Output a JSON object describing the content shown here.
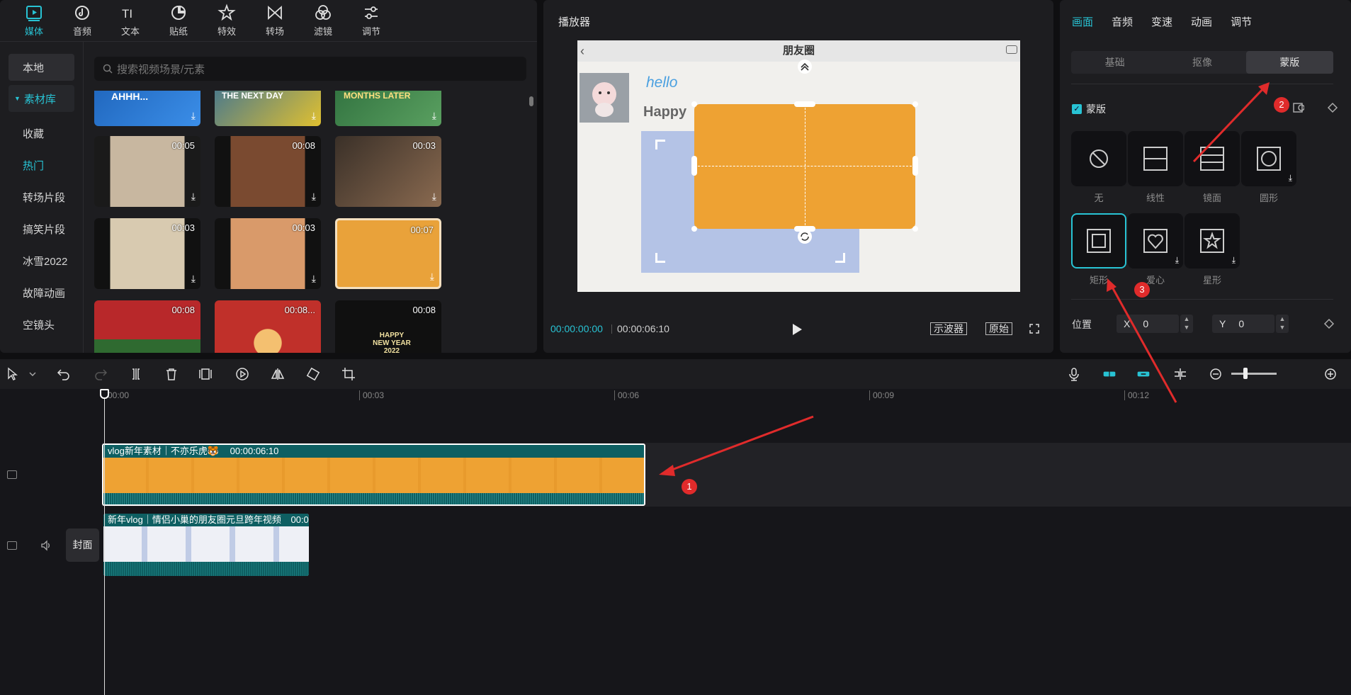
{
  "media": {
    "tabs": [
      {
        "label": "媒体",
        "icon": "media-icon",
        "active": true
      },
      {
        "label": "音频",
        "icon": "audio-icon"
      },
      {
        "label": "文本",
        "icon": "text-icon"
      },
      {
        "label": "贴纸",
        "icon": "sticker-icon"
      },
      {
        "label": "特效",
        "icon": "effects-icon"
      },
      {
        "label": "转场",
        "icon": "transition-icon"
      },
      {
        "label": "滤镜",
        "icon": "filter-icon"
      },
      {
        "label": "调节",
        "icon": "adjust-icon"
      }
    ],
    "sidebar": {
      "local": "本地",
      "library": "素材库",
      "items": [
        "收藏",
        "热门",
        "转场片段",
        "搞笑片段",
        "冰雪2022",
        "故障动画",
        "空镜头"
      ],
      "active": "热门"
    },
    "search_placeholder": "搜索视频场景/元素",
    "thumbnails": [
      {
        "duration": "",
        "text": "AHHH..."
      },
      {
        "duration": "",
        "text": "THE NEXT DAY"
      },
      {
        "duration": "",
        "text": "MONTHS LATER"
      },
      {
        "duration": "00:05"
      },
      {
        "duration": "00:08"
      },
      {
        "duration": "00:03"
      },
      {
        "duration": "00:03"
      },
      {
        "duration": "00:03"
      },
      {
        "duration": "00:07"
      },
      {
        "duration": "00:08"
      },
      {
        "duration": "00:08..."
      },
      {
        "duration": "00:08",
        "text": "HAPPY NEW YEAR 2022"
      }
    ]
  },
  "player": {
    "title": "播放器",
    "frame_title": "朋友圈",
    "hello": "hello",
    "happy": "Happy",
    "time_current": "00:00:00:00",
    "time_total": "00:00:06:10",
    "scope_btn": "示波器",
    "original_btn": "原始"
  },
  "inspector": {
    "tabs": [
      "画面",
      "音频",
      "变速",
      "动画",
      "调节"
    ],
    "active_tab": "画面",
    "segments": [
      "基础",
      "抠像",
      "蒙版"
    ],
    "active_segment": "蒙版",
    "mask_label": "蒙版",
    "mask_options": [
      {
        "label": "无",
        "icon": "none-icon"
      },
      {
        "label": "线性",
        "icon": "linear-mask-icon"
      },
      {
        "label": "镜面",
        "icon": "mirror-mask-icon"
      },
      {
        "label": "圆形",
        "icon": "circle-mask-icon",
        "download": true
      },
      {
        "label": "矩形",
        "icon": "rect-mask-icon",
        "selected": true
      },
      {
        "label": "爱心",
        "icon": "heart-mask-icon",
        "download": true
      },
      {
        "label": "星形",
        "icon": "star-mask-icon",
        "download": true
      }
    ],
    "position_label": "位置",
    "x_label": "X",
    "x_value": "0",
    "y_label": "Y",
    "y_value": "0"
  },
  "timeline": {
    "ticks": [
      "00:00",
      "00:03",
      "00:06",
      "00:09",
      "00:12"
    ],
    "clip1_title": "vlog新年素材｜不亦乐虎🐯",
    "clip1_duration": "00:00:06:10",
    "clip2_title": "新年vlog｜情侣小巢的朋友圈元旦跨年视频",
    "clip2_duration": "00:0",
    "cover_label": "封面"
  },
  "annotations": [
    "1",
    "2",
    "3"
  ],
  "colors": {
    "accent": "#28c3d4",
    "clip_orange": "#eea233",
    "clip_header": "#0e5f62",
    "annotation": "#e02b2b"
  }
}
